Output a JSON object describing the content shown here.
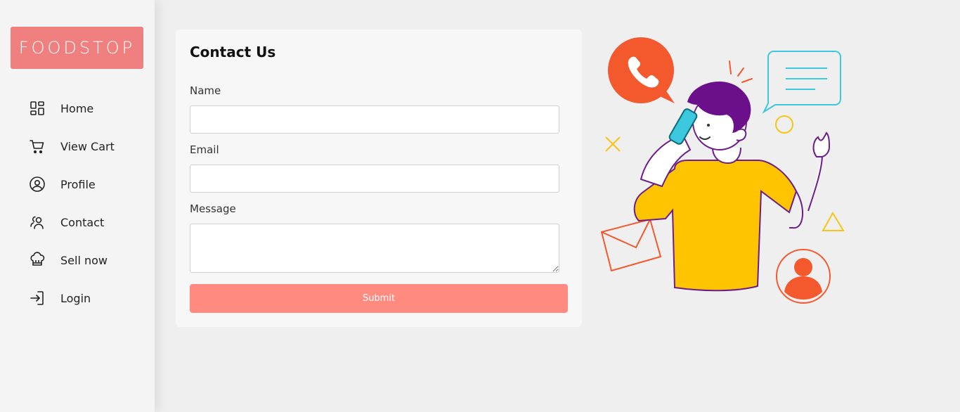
{
  "sidebar": {
    "logo_text": "FOODSTOP",
    "items": [
      {
        "label": "Home",
        "icon": "home-grid-icon"
      },
      {
        "label": "View Cart",
        "icon": "cart-icon"
      },
      {
        "label": "Profile",
        "icon": "profile-icon"
      },
      {
        "label": "Contact",
        "icon": "contact-icon"
      },
      {
        "label": "Sell now",
        "icon": "chef-hat-icon"
      },
      {
        "label": "Login",
        "icon": "login-icon"
      }
    ]
  },
  "contact_form": {
    "title": "Contact Us",
    "name_label": "Name",
    "name_value": "",
    "email_label": "Email",
    "email_value": "",
    "message_label": "Message",
    "message_value": "",
    "submit_label": "Submit"
  },
  "colors": {
    "brand": "#f08080",
    "submit": "#ff8a80",
    "sidebar_bg": "#f4f4f4",
    "page_bg": "#efefef",
    "card_bg": "#f7f7f7"
  }
}
